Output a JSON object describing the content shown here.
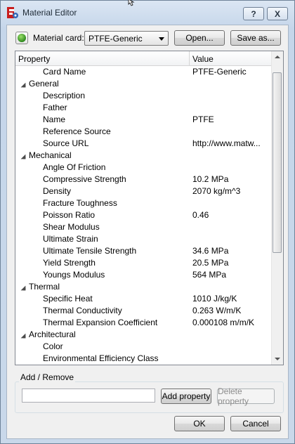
{
  "window": {
    "title": "Material Editor"
  },
  "titlebar": {
    "help_label": "?",
    "close_label": "X"
  },
  "toolbar": {
    "material_card_label": "Material card:",
    "material_card_value": "PTFE-Generic",
    "open_label": "Open...",
    "save_as_label": "Save as..."
  },
  "tree": {
    "columns": [
      "Property",
      "Value"
    ],
    "rows": [
      {
        "name": "Card Name",
        "value": "PTFE-Generic",
        "group": false
      },
      {
        "name": "General",
        "value": "",
        "group": true
      },
      {
        "name": "Description",
        "value": "",
        "group": false
      },
      {
        "name": "Father",
        "value": "",
        "group": false
      },
      {
        "name": "Name",
        "value": "PTFE",
        "group": false
      },
      {
        "name": "Reference Source",
        "value": "",
        "group": false
      },
      {
        "name": "Source URL",
        "value": "http://www.matw...",
        "group": false
      },
      {
        "name": "Mechanical",
        "value": "",
        "group": true
      },
      {
        "name": "Angle Of Friction",
        "value": "",
        "group": false
      },
      {
        "name": "Compressive Strength",
        "value": "10.2 MPa",
        "group": false
      },
      {
        "name": "Density",
        "value": "2070 kg/m^3",
        "group": false
      },
      {
        "name": "Fracture Toughness",
        "value": "",
        "group": false
      },
      {
        "name": "Poisson Ratio",
        "value": "0.46",
        "group": false
      },
      {
        "name": "Shear Modulus",
        "value": "",
        "group": false
      },
      {
        "name": "Ultimate Strain",
        "value": "",
        "group": false
      },
      {
        "name": "Ultimate Tensile Strength",
        "value": "34.6 MPa",
        "group": false
      },
      {
        "name": "Yield Strength",
        "value": "20.5 MPa",
        "group": false
      },
      {
        "name": "Youngs Modulus",
        "value": "564 MPa",
        "group": false
      },
      {
        "name": "Thermal",
        "value": "",
        "group": true
      },
      {
        "name": "Specific Heat",
        "value": "1010 J/kg/K",
        "group": false
      },
      {
        "name": "Thermal Conductivity",
        "value": "0.263 W/m/K",
        "group": false
      },
      {
        "name": "Thermal Expansion Coefficient",
        "value": "0.000108 m/m/K",
        "group": false
      },
      {
        "name": "Architectural",
        "value": "",
        "group": true
      },
      {
        "name": "Color",
        "value": "",
        "group": false
      },
      {
        "name": "Environmental Efficiency Class",
        "value": "",
        "group": false
      }
    ]
  },
  "add_remove": {
    "title": "Add / Remove",
    "input_value": "",
    "add_label": "Add property",
    "delete_label": "Delete property"
  },
  "footer": {
    "ok_label": "OK",
    "cancel_label": "Cancel"
  },
  "icons": {
    "app": "freecad-app-icon",
    "card": "material-globe-icon",
    "expanded_arrow": "expanded-arrow-icon"
  },
  "colors": {
    "accent": "#c9d8ea",
    "app_icon_red": "#c81e1e"
  }
}
